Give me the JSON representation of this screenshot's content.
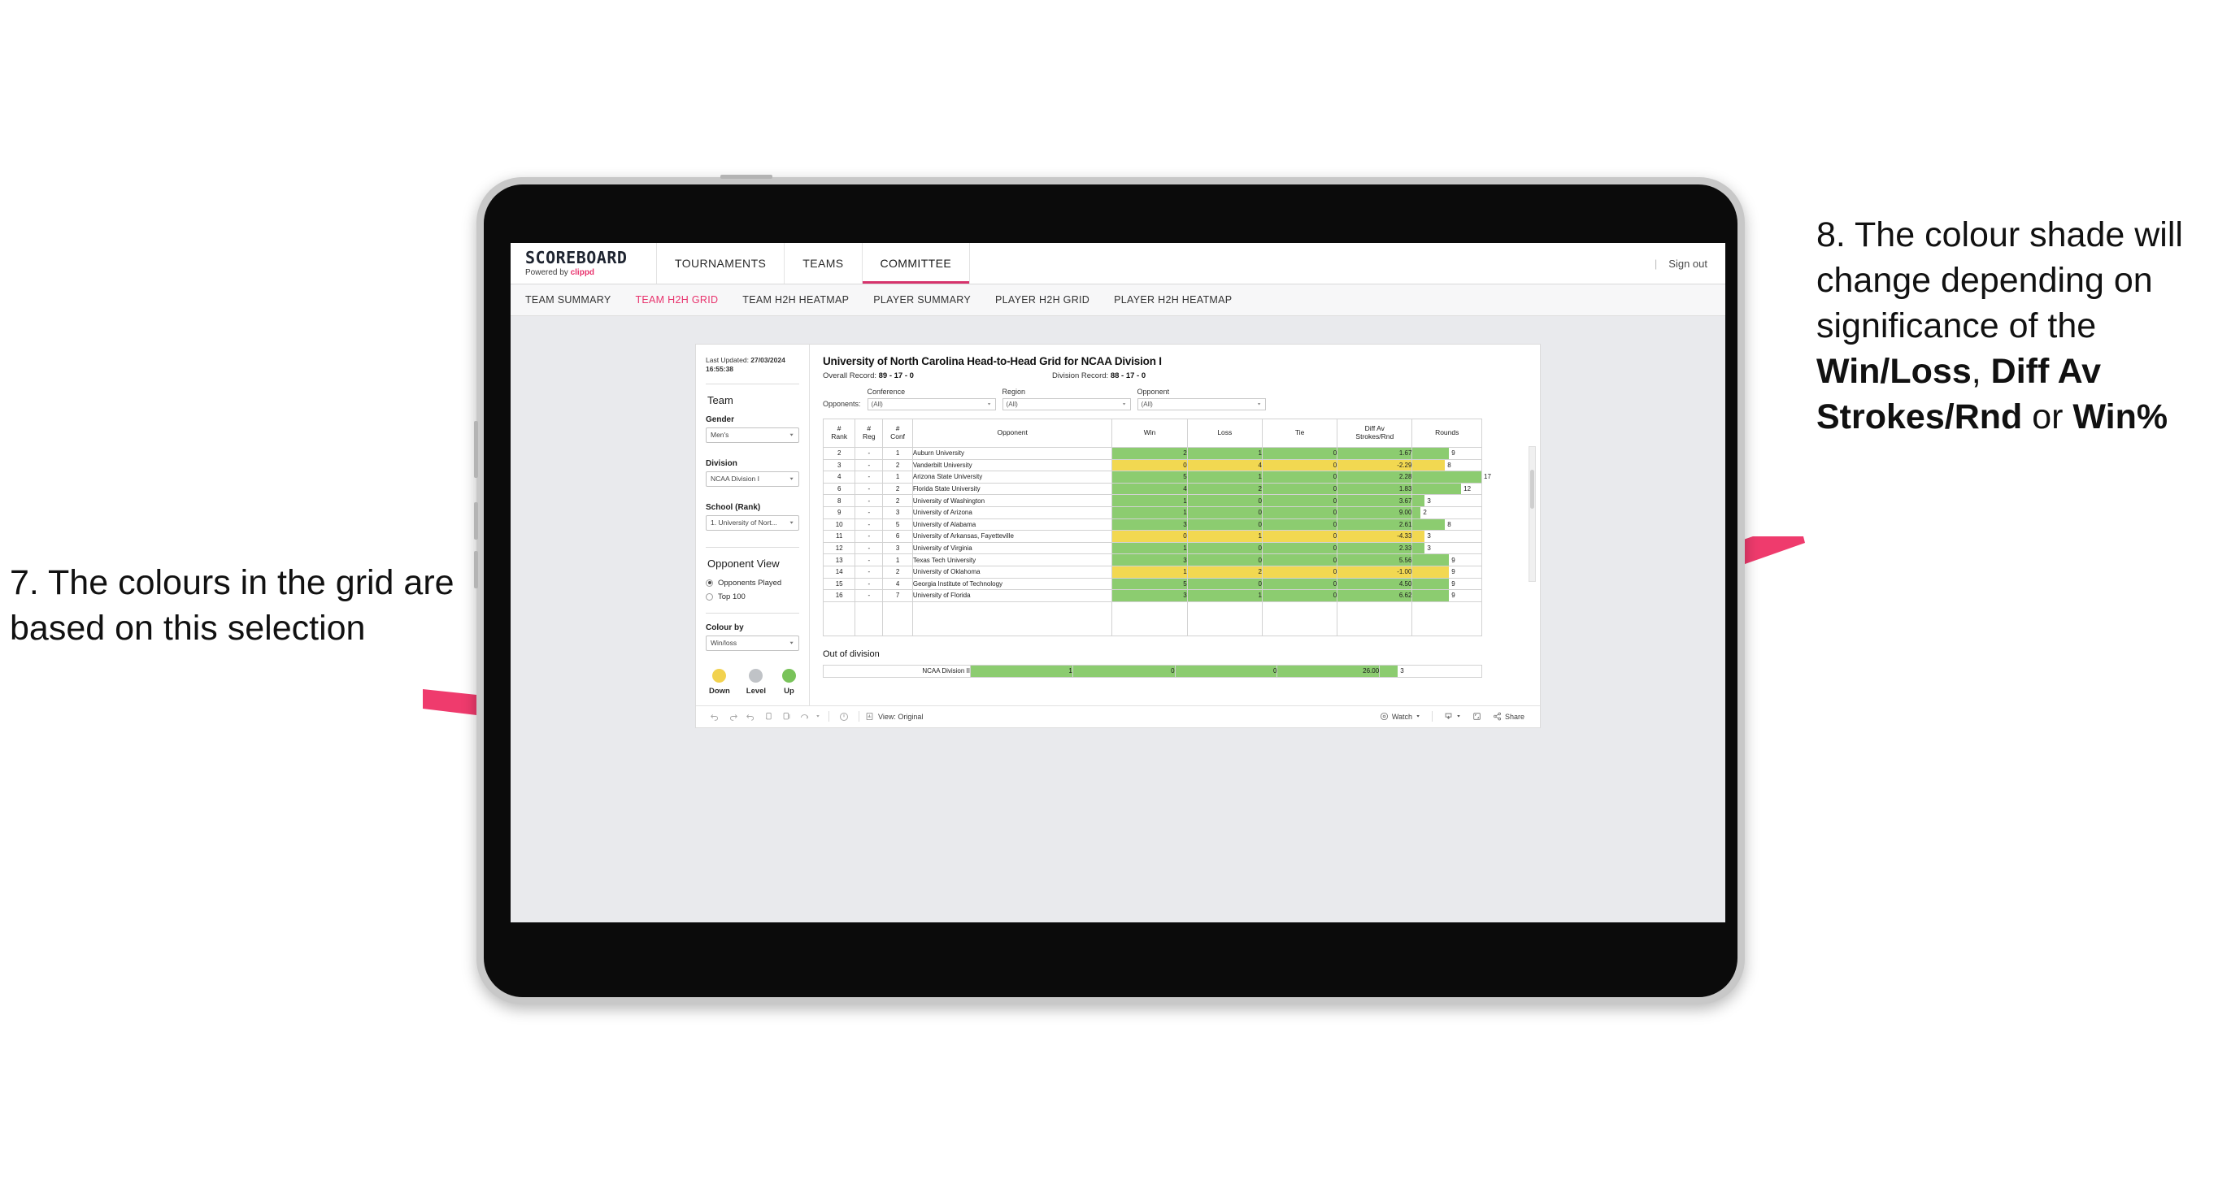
{
  "annotations": {
    "left": "7. The colours in the grid are based on this selection",
    "right_pre": "8. The colour shade will change depending on significance of the ",
    "right_b1": "Win/Loss",
    "right_mid1": ", ",
    "right_b2": "Diff Av Strokes/Rnd",
    "right_mid2": " or ",
    "right_b3": "Win%",
    "arrow_color": "#e8336d"
  },
  "topnav": {
    "brand_title": "SCOREBOARD",
    "brand_sub_prefix": "Powered by ",
    "brand_sub_name": "clippd",
    "items": [
      {
        "label": "TOURNAMENTS",
        "active": false
      },
      {
        "label": "TEAMS",
        "active": false
      },
      {
        "label": "COMMITTEE",
        "active": true
      }
    ],
    "separator": "|",
    "signout": "Sign out"
  },
  "subnav": {
    "items": [
      {
        "label": "TEAM SUMMARY",
        "active": false
      },
      {
        "label": "TEAM H2H GRID",
        "active": true
      },
      {
        "label": "TEAM H2H HEATMAP",
        "active": false
      },
      {
        "label": "PLAYER SUMMARY",
        "active": false
      },
      {
        "label": "PLAYER H2H GRID",
        "active": false
      },
      {
        "label": "PLAYER H2H HEATMAP",
        "active": false
      }
    ]
  },
  "filters": {
    "last_updated_label": "Last Updated: ",
    "last_updated_value": "27/03/2024 16:55:38",
    "team_title": "Team",
    "gender_label": "Gender",
    "gender_value": "Men's",
    "division_label": "Division",
    "division_value": "NCAA Division I",
    "school_label": "School (Rank)",
    "school_value": "1. University of Nort...",
    "opponent_view_title": "Opponent View",
    "opponent_view_options": [
      {
        "label": "Opponents Played",
        "checked": true
      },
      {
        "label": "Top 100",
        "checked": false
      }
    ],
    "colour_by_label": "Colour by",
    "colour_by_value": "Win/loss",
    "legend": [
      {
        "label": "Down",
        "color": "#f2d24f"
      },
      {
        "label": "Level",
        "color": "#c0c3c7"
      },
      {
        "label": "Up",
        "color": "#79c35a"
      }
    ]
  },
  "main": {
    "title": "University of North Carolina Head-to-Head Grid for NCAA Division I",
    "overall_record_label": "Overall Record: ",
    "overall_record_value": "89 - 17 - 0",
    "division_record_label": "Division Record: ",
    "division_record_value": "88 - 17 - 0",
    "opponents_label": "Opponents:",
    "opponent_filters": [
      {
        "label": "Conference",
        "value": "(All)"
      },
      {
        "label": "Region",
        "value": "(All)"
      },
      {
        "label": "Opponent",
        "value": "(All)"
      }
    ],
    "out_of_division_title": "Out of division"
  },
  "chart_data": {
    "type": "table",
    "title": "University of North Carolina Head-to-Head Grid for NCAA Division I",
    "columns": [
      "# Rank",
      "# Reg",
      "# Conf",
      "Opponent",
      "Win",
      "Loss",
      "Tie",
      "Diff Av Strokes/Rnd",
      "Rounds"
    ],
    "column_header_lines": [
      [
        "#",
        "Rank"
      ],
      [
        "#",
        "Reg"
      ],
      [
        "#",
        "Conf"
      ],
      [
        "Opponent"
      ],
      [
        "Win"
      ],
      [
        "Loss"
      ],
      [
        "Tie"
      ],
      [
        "Diff Av",
        "Strokes/Rnd"
      ],
      [
        "Rounds"
      ]
    ],
    "colour_by": "Win/loss",
    "rounds_max": 17,
    "colors": {
      "up": "#8ccc70",
      "down": "#f2d851",
      "level": "#c0c3c7"
    },
    "rows": [
      {
        "rank": "2",
        "reg": "-",
        "conf": "1",
        "opponent": "Auburn University",
        "win": 2,
        "loss": 1,
        "tie": 0,
        "diff": "1.67",
        "rounds": 9,
        "state": "up"
      },
      {
        "rank": "3",
        "reg": "-",
        "conf": "2",
        "opponent": "Vanderbilt University",
        "win": 0,
        "loss": 4,
        "tie": 0,
        "diff": "-2.29",
        "rounds": 8,
        "state": "down"
      },
      {
        "rank": "4",
        "reg": "-",
        "conf": "1",
        "opponent": "Arizona State University",
        "win": 5,
        "loss": 1,
        "tie": 0,
        "diff": "2.28",
        "rounds": 17,
        "state": "up"
      },
      {
        "rank": "6",
        "reg": "-",
        "conf": "2",
        "opponent": "Florida State University",
        "win": 4,
        "loss": 2,
        "tie": 0,
        "diff": "1.83",
        "rounds": 12,
        "state": "up"
      },
      {
        "rank": "8",
        "reg": "-",
        "conf": "2",
        "opponent": "University of Washington",
        "win": 1,
        "loss": 0,
        "tie": 0,
        "diff": "3.67",
        "rounds": 3,
        "state": "up"
      },
      {
        "rank": "9",
        "reg": "-",
        "conf": "3",
        "opponent": "University of Arizona",
        "win": 1,
        "loss": 0,
        "tie": 0,
        "diff": "9.00",
        "rounds": 2,
        "state": "up"
      },
      {
        "rank": "10",
        "reg": "-",
        "conf": "5",
        "opponent": "University of Alabama",
        "win": 3,
        "loss": 0,
        "tie": 0,
        "diff": "2.61",
        "rounds": 8,
        "state": "up"
      },
      {
        "rank": "11",
        "reg": "-",
        "conf": "6",
        "opponent": "University of Arkansas, Fayetteville",
        "win": 0,
        "loss": 1,
        "tie": 0,
        "diff": "-4.33",
        "rounds": 3,
        "state": "down"
      },
      {
        "rank": "12",
        "reg": "-",
        "conf": "3",
        "opponent": "University of Virginia",
        "win": 1,
        "loss": 0,
        "tie": 0,
        "diff": "2.33",
        "rounds": 3,
        "state": "up"
      },
      {
        "rank": "13",
        "reg": "-",
        "conf": "1",
        "opponent": "Texas Tech University",
        "win": 3,
        "loss": 0,
        "tie": 0,
        "diff": "5.56",
        "rounds": 9,
        "state": "up"
      },
      {
        "rank": "14",
        "reg": "-",
        "conf": "2",
        "opponent": "University of Oklahoma",
        "win": 1,
        "loss": 2,
        "tie": 0,
        "diff": "-1.00",
        "rounds": 9,
        "state": "down"
      },
      {
        "rank": "15",
        "reg": "-",
        "conf": "4",
        "opponent": "Georgia Institute of Technology",
        "win": 5,
        "loss": 0,
        "tie": 0,
        "diff": "4.50",
        "rounds": 9,
        "state": "up"
      },
      {
        "rank": "16",
        "reg": "-",
        "conf": "7",
        "opponent": "University of Florida",
        "win": 3,
        "loss": 1,
        "tie": 0,
        "diff": "6.62",
        "rounds": 9,
        "state": "up"
      }
    ],
    "out_of_division_rows": [
      {
        "opponent": "NCAA Division II",
        "win": 1,
        "loss": 0,
        "tie": 0,
        "diff": "26.00",
        "rounds": 3,
        "state": "up"
      }
    ]
  },
  "footer": {
    "view_label": "View: Original",
    "watch_label": "Watch",
    "share_label": "Share"
  }
}
